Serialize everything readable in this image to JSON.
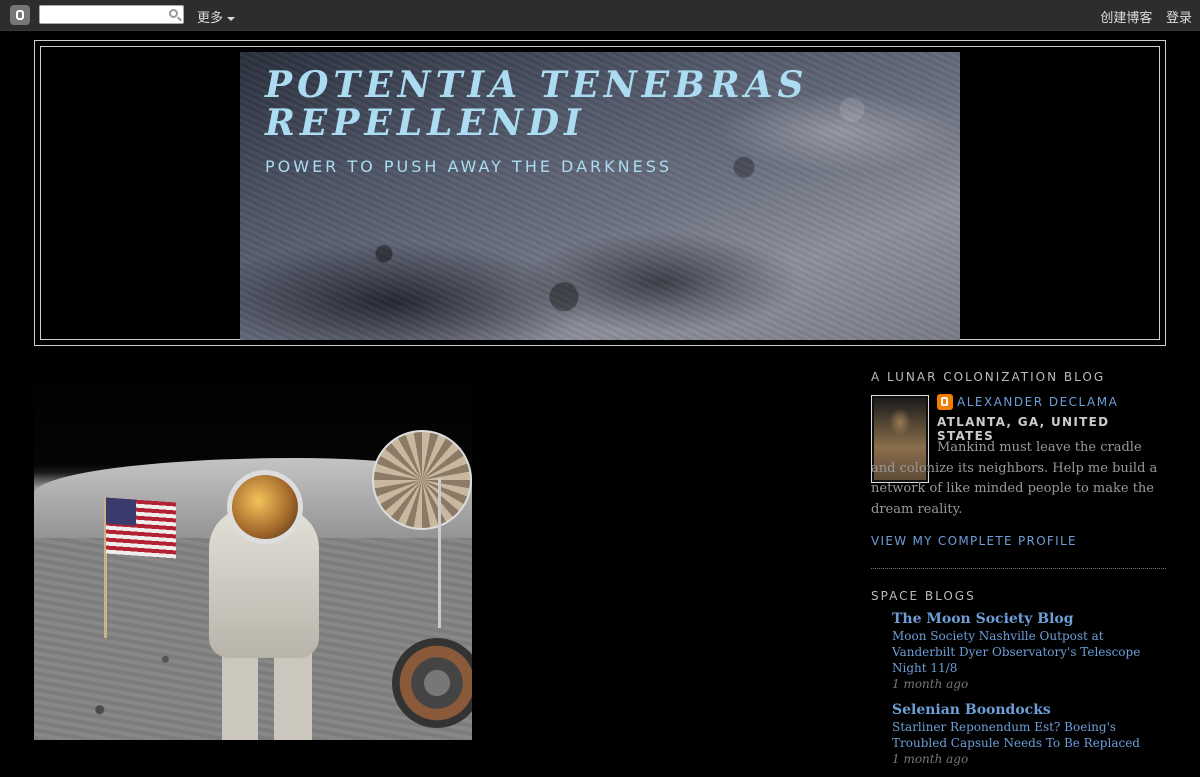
{
  "navbar": {
    "search_placeholder": "",
    "more_label": "更多",
    "create_blog": "创建博客",
    "sign_in": "登录"
  },
  "header": {
    "title": "POTENTIA TENEBRAS REPELLENDI",
    "description": "POWER TO PUSH AWAY THE DARKNESS"
  },
  "sidebar": {
    "about_heading": "A LUNAR COLONIZATION BLOG",
    "profile": {
      "name": "ALEXANDER DECLAMA",
      "location": "ATLANTA, GA, UNITED STATES",
      "about": "Mankind must leave the cradle and colonize its neighbors. Help me build a network of like minded people to make the dream reality.",
      "view_profile": "VIEW MY COMPLETE PROFILE"
    },
    "blogs_heading": "SPACE BLOGS",
    "blogs": [
      {
        "name": "The Moon Society Blog",
        "post": "Moon Society Nashville Outpost at Vanderbilt Dyer Observatory's Telescope Night 11/8",
        "age": "1 month ago"
      },
      {
        "name": "Selenian Boondocks",
        "post": "Starliner Reponendum Est? Boeing's Troubled Capsule Needs To Be Replaced",
        "age": "1 month ago"
      }
    ]
  },
  "colors": {
    "title": "#abdcf2",
    "link": "#6c9ed8",
    "background": "#000000",
    "navbar": "#2d2d2d"
  }
}
